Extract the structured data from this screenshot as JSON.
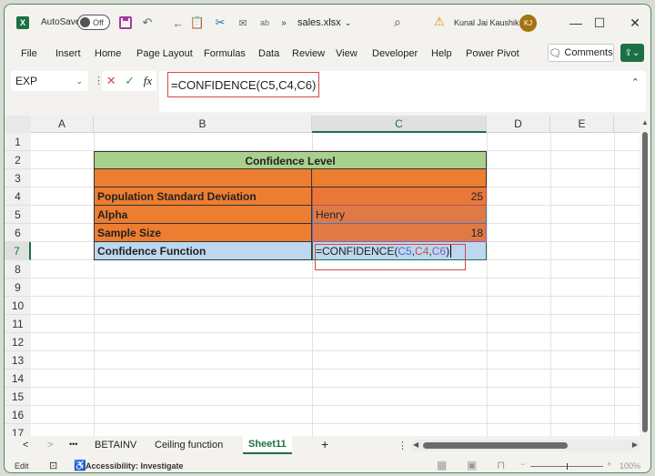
{
  "titlebar": {
    "app_icon": "X",
    "autosave_label": "AutoSave",
    "autosave_state": "Off",
    "filename": "sales.xlsx",
    "user_name": "Kunal Jai Kaushik",
    "user_initials": "KJ",
    "minimize": "—",
    "maximize": "☐",
    "close": "✕",
    "overflow": "»"
  },
  "ribbon": {
    "tabs": [
      "File",
      "Insert",
      "Home",
      "Page Layout",
      "Formulas",
      "Data",
      "Review",
      "View",
      "Developer",
      "Help",
      "Power Pivot"
    ],
    "comments_label": "Comments"
  },
  "formula_bar": {
    "name_box": "EXP",
    "formula": "=CONFIDENCE(C5,C4,C6)",
    "cancel": "✕",
    "enter": "✓",
    "fx": "fx"
  },
  "sheet": {
    "columns": [
      "A",
      "B",
      "C",
      "D",
      "E"
    ],
    "selected_column": "C",
    "rows": [
      "1",
      "2",
      "3",
      "4",
      "5",
      "6",
      "7",
      "8",
      "9",
      "10",
      "11",
      "12",
      "13",
      "14",
      "15",
      "16",
      "17"
    ],
    "selected_row": "7",
    "title": "Confidence Level",
    "labels": {
      "b4": "Population Standard Deviation",
      "b5": "Alpha",
      "b6": "Sample Size",
      "b7": "Confidence Function"
    },
    "values": {
      "c4": "25",
      "c5": "Henry",
      "c6": "18"
    },
    "editing_formula": {
      "prefix": "=CONFIDENCE(",
      "arg1": "C5",
      "sep1": ",",
      "arg2": "C4",
      "sep2": ",",
      "arg3": "C6",
      "suffix": ")"
    },
    "colors": {
      "header_green": "#a9d08e",
      "orange": "#ed7d31",
      "light_blue": "#bdd7ee",
      "ref_blue": "#4472c4",
      "ref_red": "#c0504d",
      "ref_purple": "#7f5fbf"
    }
  },
  "sheet_tabs": {
    "more": "•••",
    "tabs": [
      "BETAINV",
      "Ceiling function",
      "Sheet11"
    ],
    "active": "Sheet11",
    "add": "+"
  },
  "statusbar": {
    "mode": "Edit",
    "accessibility": "Accessibility: Investigate",
    "zoom_minus": "−",
    "zoom_plus": "+",
    "zoom": "100%"
  }
}
